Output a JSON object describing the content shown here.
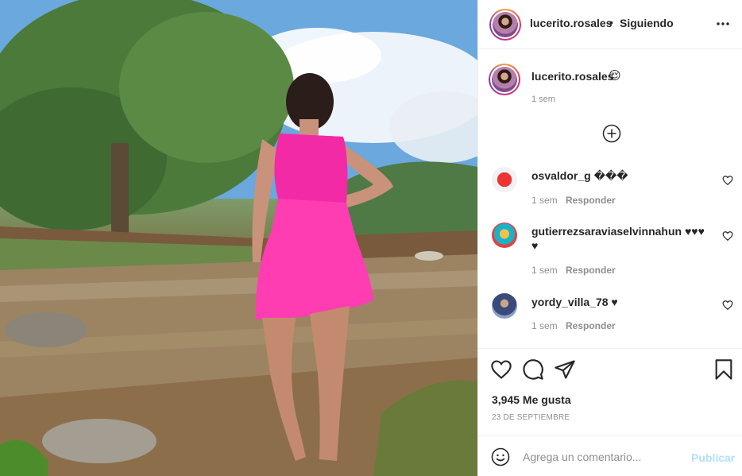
{
  "header": {
    "username": "lucerito.rosales",
    "separator": "•",
    "follow_status": "Siguiendo"
  },
  "caption": {
    "username": "lucerito.rosales",
    "emoji": "😌",
    "time": "1 sem"
  },
  "comments": [
    {
      "username": "osvaldor_g",
      "text": "���",
      "time": "1 sem",
      "reply": "Responder"
    },
    {
      "username": "gutierrezsaraviaselvinnahun",
      "text": "♥♥♥",
      "text2": "♥",
      "time": "1 sem",
      "reply": "Responder"
    },
    {
      "username": "yordy_villa_78",
      "text": "♥",
      "time": "1 sem",
      "reply": "Responder"
    }
  ],
  "likes": "3,945 Me gusta",
  "date": "23 DE SEPTIEMBRE",
  "composer": {
    "placeholder": "Agrega un comentario...",
    "publish": "Publicar"
  },
  "icons": [
    "more-icon",
    "add-comment-icon",
    "heart-icon",
    "comment-icon",
    "share-icon",
    "bookmark-icon",
    "emoji-icon"
  ],
  "colors": {
    "accent_disabled": "#b2dffc",
    "muted": "#8e8e8e",
    "text": "#262626"
  }
}
